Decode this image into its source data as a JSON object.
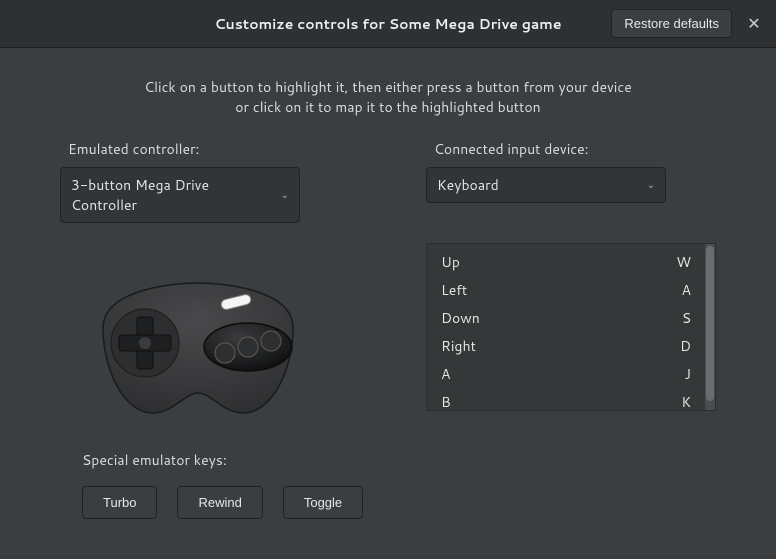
{
  "header": {
    "title": "Customize controls for Some Mega Drive game",
    "restore_label": "Restore defaults"
  },
  "instructions": {
    "line1": "Click on a button to highlight it, then either press a button from your device",
    "line2": "or click on it to map it to the highlighted button"
  },
  "emulated": {
    "label": "Emulated controller:",
    "value": "3-button Mega Drive Controller"
  },
  "device": {
    "label": "Connected input device:",
    "value": "Keyboard"
  },
  "bindings": [
    {
      "action": "Up",
      "key": "W"
    },
    {
      "action": "Left",
      "key": "A"
    },
    {
      "action": "Down",
      "key": "S"
    },
    {
      "action": "Right",
      "key": "D"
    },
    {
      "action": "A",
      "key": "J"
    },
    {
      "action": "B",
      "key": "K"
    }
  ],
  "special": {
    "label": "Special emulator keys:",
    "buttons": [
      "Turbo",
      "Rewind",
      "Toggle"
    ]
  }
}
